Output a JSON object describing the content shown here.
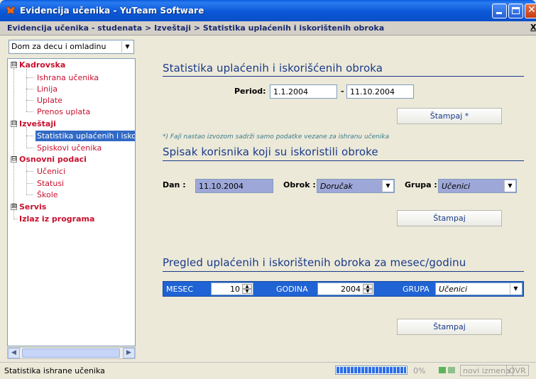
{
  "window": {
    "title": "Evidencija učenika - YuTeam Software"
  },
  "breadcrumb": {
    "text": "Evidencija učenika - studenata > Izveštaji > Statistika uplaćenih i iskorištenih obroka",
    "close_label": "X"
  },
  "sidebar": {
    "institution_select": "Dom za decu i omladinu",
    "tree": [
      {
        "label": "Kadrovska",
        "type": "group",
        "expander": "⊟"
      },
      {
        "label": "Ishrana učenika",
        "type": "leaf"
      },
      {
        "label": "Linija",
        "type": "leaf"
      },
      {
        "label": "Uplate",
        "type": "leaf"
      },
      {
        "label": "Prenos uplata",
        "type": "leaf"
      },
      {
        "label": "Izveštaji",
        "type": "group",
        "expander": "⊟"
      },
      {
        "label": "Statistika uplaćenih i isko",
        "type": "leaf",
        "selected": true
      },
      {
        "label": "Spiskovi učenika",
        "type": "leaf"
      },
      {
        "label": "Osnovni podaci",
        "type": "group",
        "expander": "⊟"
      },
      {
        "label": "Učenici",
        "type": "leaf"
      },
      {
        "label": "Statusi",
        "type": "leaf"
      },
      {
        "label": "Škole",
        "type": "leaf"
      },
      {
        "label": "Servis",
        "type": "group",
        "expander": "⊞"
      },
      {
        "label": "Izlaz iz programa",
        "type": "group"
      }
    ]
  },
  "stats_section": {
    "title": "Statistika uplaćenih i iskorišćenih obroka",
    "period_label": "Period:",
    "period_from": "1.1.2004",
    "period_sep": "-",
    "period_to": "11.10.2004",
    "print_label": "Štampaj *",
    "note": "*) Fajl nastao izvozom sadrži samo podatke vezane za ishranu učenika"
  },
  "users_section": {
    "title": "Spisak korisnika koji su iskoristili obroke",
    "day_label": "Dan :",
    "day_value": "11.10.2004",
    "meal_label": "Obrok :",
    "meal_value": "Doručak",
    "group_label": "Grupa :",
    "group_value": "Učenici",
    "print_label": "Štampaj"
  },
  "monthly_section": {
    "title": "Pregled uplaćenih i iskorištenih obroka za mesec/godinu",
    "month_label": "MESEC",
    "month_value": "10",
    "year_label": "GODINA",
    "year_value": "2004",
    "group_label": "GRUPA",
    "group_value": "Učenici",
    "print_label": "Štampaj"
  },
  "statusbar": {
    "text": "Statistika ishrane učenika",
    "progress": 1.0,
    "percent_text": "0%",
    "new_changes": "novi izmena",
    "ovr": "OVR",
    "colors": {
      "progress": "#2c6ee8",
      "ind1": "#5ab55a",
      "ind2": "#8fbf8f"
    }
  },
  "colors": {
    "accent": "#1f63d4",
    "tree_text": "#c8102e",
    "section_title": "#1a3a8a",
    "highlight_field": "#9ea8d8"
  }
}
